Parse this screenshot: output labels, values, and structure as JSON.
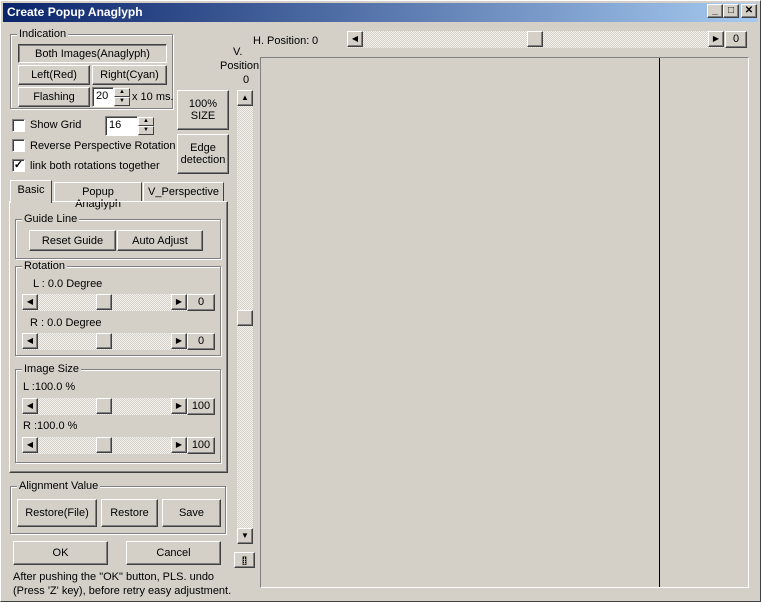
{
  "window": {
    "title": "Create Popup Anaglyph",
    "controls": {
      "minimize": "_",
      "maximize": "□",
      "close": "✕"
    }
  },
  "indication": {
    "group_label": "Indication",
    "both_button": "Both Images(Anaglyph)",
    "left_button": "Left(Red)",
    "right_button": "Right(Cyan)",
    "flashing_button": "Flashing",
    "flash_interval_value": "20",
    "flash_unit": "x 10 ms."
  },
  "size_button_line1": "100%",
  "size_button_line2": "SIZE",
  "edge_button_line1": "Edge",
  "edge_button_line2": "detection",
  "options": {
    "show_grid_label": "Show Grid",
    "show_grid_checked": false,
    "grid_value": "16",
    "reverse_label": "Reverse Perspective Rotation",
    "reverse_checked": false,
    "link_label": "link both rotations together",
    "link_checked": true
  },
  "tabs": [
    {
      "label": "Basic",
      "active": true
    },
    {
      "label": "Popup Anaglyph",
      "active": false
    },
    {
      "label": "V_Perspective",
      "active": false
    }
  ],
  "guide_line": {
    "group_label": "Guide Line",
    "reset_button": "Reset Guide",
    "auto_button": "Auto Adjust"
  },
  "rotation": {
    "group_label": "Rotation",
    "left_label": "L : 0.0 Degree",
    "left_value": "0",
    "right_label": "R : 0.0 Degree",
    "right_value": "0"
  },
  "image_size": {
    "group_label": "Image Size",
    "left_label": "L :100.0 %",
    "left_value": "100",
    "right_label": "R :100.0 %",
    "right_value": "100"
  },
  "alignment": {
    "group_label": "Alignment Value",
    "restore_file_button": "Restore(File)",
    "restore_button": "Restore",
    "save_button": "Save"
  },
  "ok_button": "OK",
  "cancel_button": "Cancel",
  "note_line1": "After pushing the \"OK\" button, PLS. undo",
  "note_line2": "(Press 'Z' key), before retry easy adjustment.",
  "h_position": {
    "label": "H. Position:",
    "value": "0",
    "box_value": "0"
  },
  "v_position": {
    "label_line1": "V.",
    "label_line2": "Position",
    "value": "0"
  },
  "icons": {
    "arrow_left": "◀",
    "arrow_right": "▶",
    "arrow_up": "▲",
    "arrow_down": "▼",
    "check": "✓",
    "reset_icon": "[]"
  }
}
